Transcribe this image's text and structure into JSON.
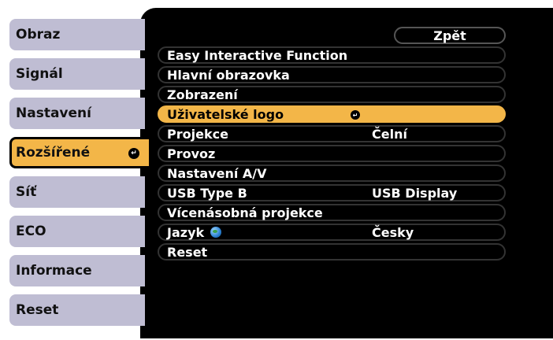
{
  "sidebar": {
    "items": [
      {
        "label": "Obraz"
      },
      {
        "label": "Signál"
      },
      {
        "label": "Nastavení"
      },
      {
        "label": "Rozšířené",
        "active": true
      },
      {
        "label": "Síť"
      },
      {
        "label": "ECO"
      },
      {
        "label": "Informace"
      },
      {
        "label": "Reset"
      }
    ]
  },
  "menu": {
    "back_label": "Zpět",
    "rows": [
      {
        "label": "Easy Interactive Function",
        "value": ""
      },
      {
        "label": "Hlavní obrazovka",
        "value": ""
      },
      {
        "label": "Zobrazení",
        "value": ""
      },
      {
        "label": "Uživatelské logo",
        "value": "",
        "selected": true
      },
      {
        "label": "Projekce",
        "value": "Čelní"
      },
      {
        "label": "Provoz",
        "value": ""
      },
      {
        "label": "Nastavení A/V",
        "value": ""
      },
      {
        "label": "USB Type B",
        "value": "USB Display"
      },
      {
        "label": "Vícenásobná projekce",
        "value": ""
      },
      {
        "label": "Jazyk",
        "value": "Česky"
      },
      {
        "label": "Reset",
        "value": ""
      }
    ]
  },
  "colors": {
    "sidebar_bg": "#bfbdd3",
    "accent": "#f3b648",
    "panel_bg": "#000000"
  },
  "icons": {
    "enter": "enter-arrow-icon",
    "globe": "globe-icon"
  }
}
